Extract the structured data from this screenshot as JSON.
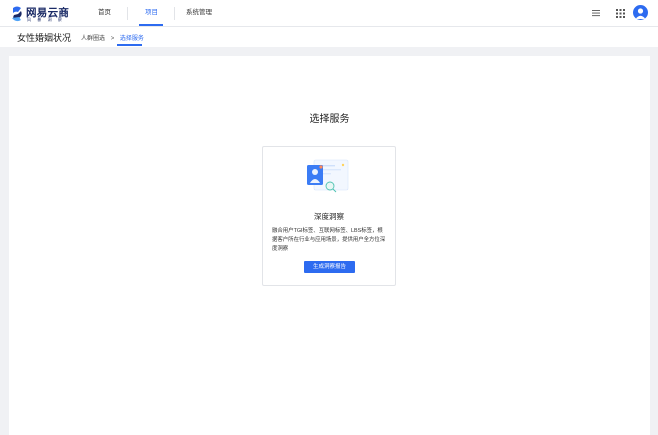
{
  "brand": {
    "name": "网易云商",
    "tagline": "风 暴 洞 察"
  },
  "nav": {
    "items": [
      {
        "label": "首页",
        "active": false
      },
      {
        "label": "项目",
        "active": true
      },
      {
        "label": "系统管理",
        "active": false
      }
    ]
  },
  "header_icons": {
    "menu": "menu-icon",
    "apps": "apps-grid-icon",
    "avatar": "user-avatar-icon"
  },
  "subheader": {
    "title": "女性婚姻状况",
    "breadcrumb": {
      "parent": "人群圈选",
      "separator": ">",
      "current": "选择服务"
    }
  },
  "main": {
    "section_title": "选择服务",
    "card": {
      "title": "深度洞察",
      "description": "融合用户TGI标签、互联网标签、LBS标签，根据客户所在行业与应用场景，提供用户全方位深度洞察",
      "button_label": "生成洞察报告"
    }
  },
  "colors": {
    "accent": "#2d6bf0",
    "brand_text": "#1a2a66",
    "page_background": "#f0f1f4"
  }
}
